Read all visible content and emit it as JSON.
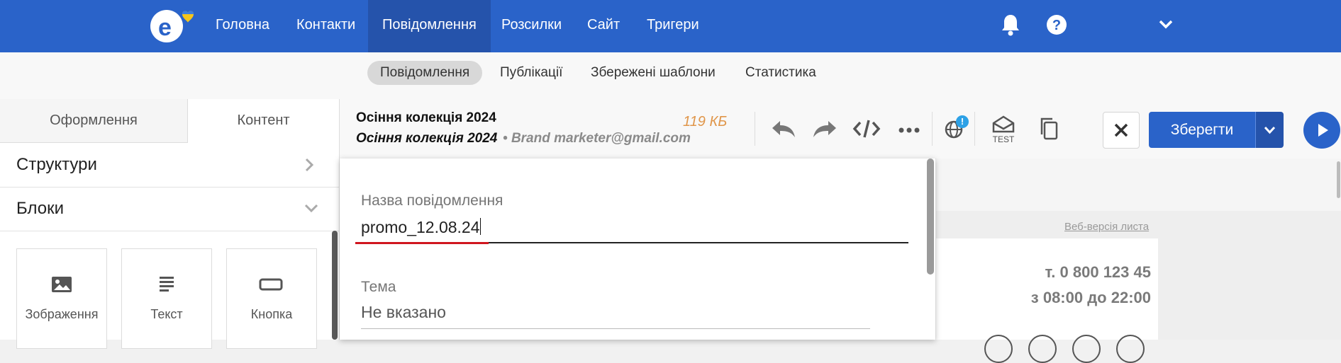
{
  "nav": {
    "items": [
      {
        "label": "Головна"
      },
      {
        "label": "Контакти"
      },
      {
        "label": "Повідомлення"
      },
      {
        "label": "Розсилки"
      },
      {
        "label": "Сайт"
      },
      {
        "label": "Тригери"
      }
    ],
    "active_index": 2
  },
  "subnav": {
    "items": [
      {
        "label": "Повідомлення"
      },
      {
        "label": "Публікації"
      },
      {
        "label": "Збережені шаблони"
      },
      {
        "label": "Статистика"
      }
    ],
    "active_index": 0
  },
  "left": {
    "tabs": [
      {
        "label": "Оформлення"
      },
      {
        "label": "Контент"
      }
    ],
    "active_tab": 1,
    "sections": [
      {
        "label": "Структури"
      },
      {
        "label": "Блоки"
      }
    ],
    "blocks": [
      {
        "label": "Зображення"
      },
      {
        "label": "Текст"
      },
      {
        "label": "Кнопка"
      }
    ]
  },
  "toolbar": {
    "title": "Осіння колекція 2024",
    "subject": "Осіння колекція 2024",
    "sender": "Brand marketer@gmail.com",
    "size": "119 КБ",
    "test_label": "TEST",
    "save_label": "Зберегти",
    "notice_badge": "!"
  },
  "popup": {
    "name_label": "Назва повідомлення",
    "name_value": "promo_12.08.24",
    "subject_label": "Тема",
    "subject_value": "Не вказано"
  },
  "preview": {
    "web_version": "Веб-версія листа",
    "phone": "т. 0 800 123 45",
    "hours": "з 08:00 до 22:00"
  },
  "colors": {
    "brand": "#2a63c9",
    "accent_orange": "#e0964a",
    "error_red": "#d0161f"
  }
}
